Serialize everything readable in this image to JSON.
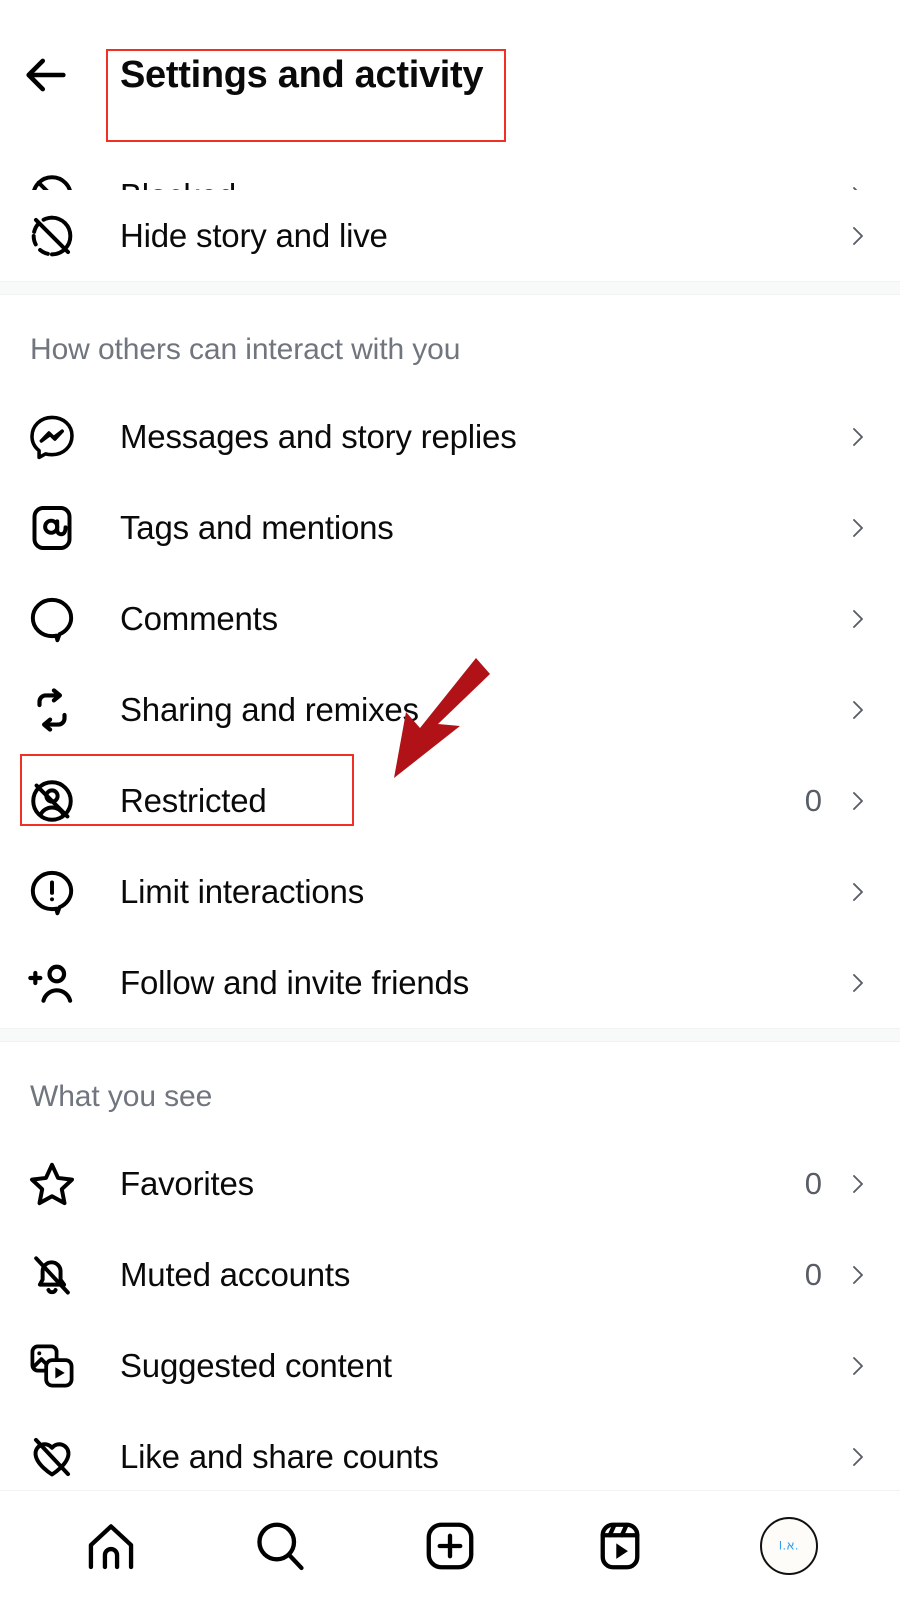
{
  "header": {
    "title": "Settings and activity",
    "back_icon": "arrow-left-icon"
  },
  "annotations": {
    "box_color": "#ee3124",
    "arrow_color": "#b01217",
    "title_box_target": "Settings and activity",
    "row_box_target": "Restricted",
    "arrow_points_to": "Restricted"
  },
  "list": {
    "partial_top_row": {
      "label": "Blocked",
      "icon": "blocked-circle-icon",
      "count": "",
      "chevron": "chevron-right-icon"
    },
    "top_rows": [
      {
        "label": "Hide story and live",
        "icon": "hide-story-slash-icon",
        "count": "",
        "chevron": "chevron-right-icon"
      }
    ],
    "sections": [
      {
        "title": "How others can interact with you",
        "rows": [
          {
            "label": "Messages and story replies",
            "icon": "messenger-bolt-icon",
            "count": "",
            "chevron": "chevron-right-icon"
          },
          {
            "label": "Tags and mentions",
            "icon": "at-square-icon",
            "count": "",
            "chevron": "chevron-right-icon"
          },
          {
            "label": "Comments",
            "icon": "comment-bubble-icon",
            "count": "",
            "chevron": "chevron-right-icon"
          },
          {
            "label": "Sharing and remixes",
            "icon": "remix-loop-icon",
            "count": "",
            "chevron": "chevron-right-icon"
          },
          {
            "label": "Restricted",
            "icon": "restricted-person-slash-icon",
            "count": "0",
            "chevron": "chevron-right-icon",
            "highlighted": true
          },
          {
            "label": "Limit interactions",
            "icon": "exclamation-bubble-icon",
            "count": "",
            "chevron": "chevron-right-icon"
          },
          {
            "label": "Follow and invite friends",
            "icon": "person-plus-icon",
            "count": "",
            "chevron": "chevron-right-icon"
          }
        ]
      },
      {
        "title": "What you see",
        "rows": [
          {
            "label": "Favorites",
            "icon": "star-icon",
            "count": "0",
            "chevron": "chevron-right-icon"
          },
          {
            "label": "Muted accounts",
            "icon": "bell-slash-icon",
            "count": "0",
            "chevron": "chevron-right-icon"
          },
          {
            "label": "Suggested content",
            "icon": "suggested-cards-icon",
            "count": "",
            "chevron": "chevron-right-icon"
          },
          {
            "label": "Like and share counts",
            "icon": "heart-slash-icon",
            "count": "",
            "chevron": "chevron-right-icon"
          }
        ]
      }
    ]
  },
  "bottom_nav": {
    "items": [
      {
        "name": "home",
        "icon": "home-icon"
      },
      {
        "name": "search",
        "icon": "search-icon"
      },
      {
        "name": "create",
        "icon": "plus-square-icon"
      },
      {
        "name": "reels",
        "icon": "reels-icon"
      },
      {
        "name": "profile",
        "icon": "avatar-icon",
        "avatar_text": "l.ﬡ."
      }
    ]
  }
}
